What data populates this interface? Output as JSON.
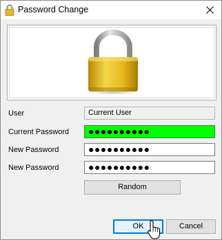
{
  "window": {
    "title": "Password Change"
  },
  "form": {
    "user_label": "User",
    "user_value": "Current User",
    "current_password_label": "Current Password",
    "current_password_value": "●●●●●●●●●●",
    "new_password_label": "New Password",
    "new_password_value": "●●●●●●●●●●",
    "confirm_password_label": "New Password",
    "confirm_password_value": "●●●●●●●●●●"
  },
  "buttons": {
    "random": "Random",
    "ok": "OK",
    "cancel": "Cancel"
  },
  "colors": {
    "active_field": "#00ff00",
    "lock_gold": "#e8c030",
    "default_button_border": "#0078d7"
  },
  "icons": {
    "title": "padlock-icon",
    "close": "close-icon",
    "banner": "padlock-icon",
    "pointer": "mouse-pointer-icon"
  }
}
